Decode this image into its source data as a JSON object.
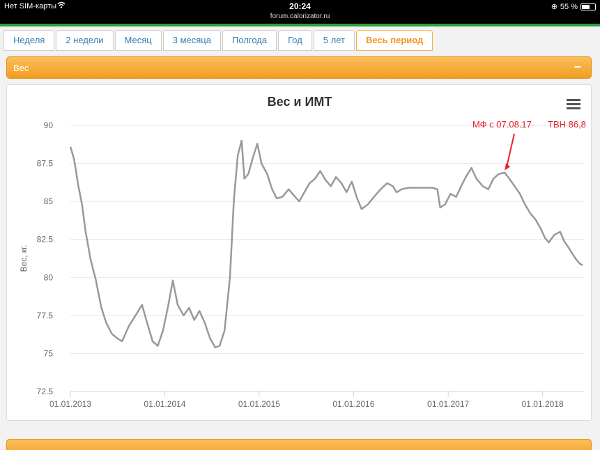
{
  "statusbar": {
    "carrier": "Нет SIM-карты",
    "wifi_icon": "wifi-icon",
    "time": "20:24",
    "url": "forum.calorizator.ru",
    "battery_text": "55 %",
    "battery_level": 0.55
  },
  "tabs": [
    {
      "label": "Неделя"
    },
    {
      "label": "2 недели"
    },
    {
      "label": "Месяц"
    },
    {
      "label": "3 месяца"
    },
    {
      "label": "Полгода"
    },
    {
      "label": "Год"
    },
    {
      "label": "5 лет"
    },
    {
      "label": "Весь период",
      "active": true
    }
  ],
  "panel": {
    "title": "Вес",
    "collapse_label": "−",
    "menu_icon": "hamburger-menu-icon"
  },
  "colors": {
    "accent": "#f29d1f",
    "tab_text": "#2f7fb5",
    "series": "#999999",
    "annotation": "#e8202a"
  },
  "chart_data": {
    "type": "line",
    "title": "Вес и ИМТ",
    "ylabel": "Вес, кг.",
    "xlabel": "",
    "ylim": [
      72.5,
      90
    ],
    "yticks": [
      "72.5",
      "75",
      "77.5",
      "80",
      "82.5",
      "85",
      "87.5",
      "90"
    ],
    "xlim": [
      "2013-01-01",
      "2018-06-10"
    ],
    "xticks": [
      "01.01.2013",
      "01.01.2014",
      "01.01.2015",
      "01.01.2016",
      "01.01.2017",
      "01.01.2018"
    ],
    "grid": true,
    "series": [
      {
        "points": [
          [
            "2013-01-01",
            88.6
          ],
          [
            "2013-01-15",
            87.8
          ],
          [
            "2013-02-01",
            86.0
          ],
          [
            "2013-02-15",
            84.8
          ],
          [
            "2013-03-01",
            83.0
          ],
          [
            "2013-03-20",
            81.2
          ],
          [
            "2013-04-10",
            79.8
          ],
          [
            "2013-05-01",
            78.0
          ],
          [
            "2013-05-20",
            77.0
          ],
          [
            "2013-06-10",
            76.3
          ],
          [
            "2013-07-01",
            76.0
          ],
          [
            "2013-07-20",
            75.8
          ],
          [
            "2013-08-15",
            76.8
          ],
          [
            "2013-09-10",
            77.5
          ],
          [
            "2013-10-05",
            78.2
          ],
          [
            "2013-10-25",
            77.0
          ],
          [
            "2013-11-15",
            75.8
          ],
          [
            "2013-12-05",
            75.5
          ],
          [
            "2013-12-25",
            76.5
          ],
          [
            "2014-01-15",
            78.2
          ],
          [
            "2014-02-01",
            79.8
          ],
          [
            "2014-02-20",
            78.2
          ],
          [
            "2014-03-15",
            77.5
          ],
          [
            "2014-04-05",
            78.0
          ],
          [
            "2014-04-25",
            77.2
          ],
          [
            "2014-05-15",
            77.8
          ],
          [
            "2014-06-05",
            77.0
          ],
          [
            "2014-06-25",
            76.0
          ],
          [
            "2014-07-15",
            75.4
          ],
          [
            "2014-08-01",
            75.5
          ],
          [
            "2014-08-20",
            76.5
          ],
          [
            "2014-09-10",
            80.0
          ],
          [
            "2014-09-25",
            85.0
          ],
          [
            "2014-10-10",
            88.0
          ],
          [
            "2014-10-25",
            89.0
          ],
          [
            "2014-11-05",
            86.5
          ],
          [
            "2014-11-20",
            86.8
          ],
          [
            "2014-12-10",
            88.0
          ],
          [
            "2014-12-25",
            88.8
          ],
          [
            "2015-01-10",
            87.5
          ],
          [
            "2015-02-01",
            86.8
          ],
          [
            "2015-02-20",
            85.8
          ],
          [
            "2015-03-10",
            85.2
          ],
          [
            "2015-04-01",
            85.3
          ],
          [
            "2015-04-25",
            85.8
          ],
          [
            "2015-05-15",
            85.4
          ],
          [
            "2015-06-05",
            85.0
          ],
          [
            "2015-06-25",
            85.6
          ],
          [
            "2015-07-15",
            86.2
          ],
          [
            "2015-08-05",
            86.5
          ],
          [
            "2015-08-25",
            87.0
          ],
          [
            "2015-09-15",
            86.4
          ],
          [
            "2015-10-05",
            86.0
          ],
          [
            "2015-10-25",
            86.6
          ],
          [
            "2015-11-15",
            86.2
          ],
          [
            "2015-12-05",
            85.6
          ],
          [
            "2015-12-25",
            86.3
          ],
          [
            "2016-01-15",
            85.2
          ],
          [
            "2016-02-01",
            84.5
          ],
          [
            "2016-02-25",
            84.8
          ],
          [
            "2016-03-20",
            85.3
          ],
          [
            "2016-04-15",
            85.8
          ],
          [
            "2016-05-10",
            86.2
          ],
          [
            "2016-06-01",
            86.0
          ],
          [
            "2016-06-15",
            85.6
          ],
          [
            "2016-07-05",
            85.8
          ],
          [
            "2016-08-01",
            85.9
          ],
          [
            "2016-09-01",
            85.9
          ],
          [
            "2016-10-01",
            85.9
          ],
          [
            "2016-11-01",
            85.9
          ],
          [
            "2016-11-20",
            85.8
          ],
          [
            "2016-12-01",
            84.6
          ],
          [
            "2016-12-20",
            84.8
          ],
          [
            "2017-01-10",
            85.5
          ],
          [
            "2017-02-01",
            85.3
          ],
          [
            "2017-02-20",
            86.0
          ],
          [
            "2017-03-10",
            86.6
          ],
          [
            "2017-04-01",
            87.2
          ],
          [
            "2017-04-20",
            86.5
          ],
          [
            "2017-05-15",
            86.0
          ],
          [
            "2017-06-05",
            85.8
          ],
          [
            "2017-06-25",
            86.5
          ],
          [
            "2017-07-15",
            86.8
          ],
          [
            "2017-08-07",
            86.9
          ],
          [
            "2017-08-25",
            86.5
          ],
          [
            "2017-09-15",
            86.0
          ],
          [
            "2017-10-05",
            85.5
          ],
          [
            "2017-10-25",
            84.8
          ],
          [
            "2017-11-15",
            84.2
          ],
          [
            "2017-12-05",
            83.8
          ],
          [
            "2017-12-25",
            83.2
          ],
          [
            "2018-01-10",
            82.6
          ],
          [
            "2018-01-25",
            82.3
          ],
          [
            "2018-02-15",
            82.8
          ],
          [
            "2018-03-10",
            83.0
          ],
          [
            "2018-03-25",
            82.4
          ],
          [
            "2018-04-10",
            82.0
          ],
          [
            "2018-04-25",
            81.6
          ],
          [
            "2018-05-10",
            81.2
          ],
          [
            "2018-05-25",
            80.9
          ],
          [
            "2018-06-05",
            80.8
          ]
        ]
      }
    ],
    "annotations": [
      {
        "text": "МФ с 07.08.17",
        "target": [
          "2017-08-07",
          87.0
        ]
      },
      {
        "text": "ТВН 86,8"
      }
    ]
  }
}
